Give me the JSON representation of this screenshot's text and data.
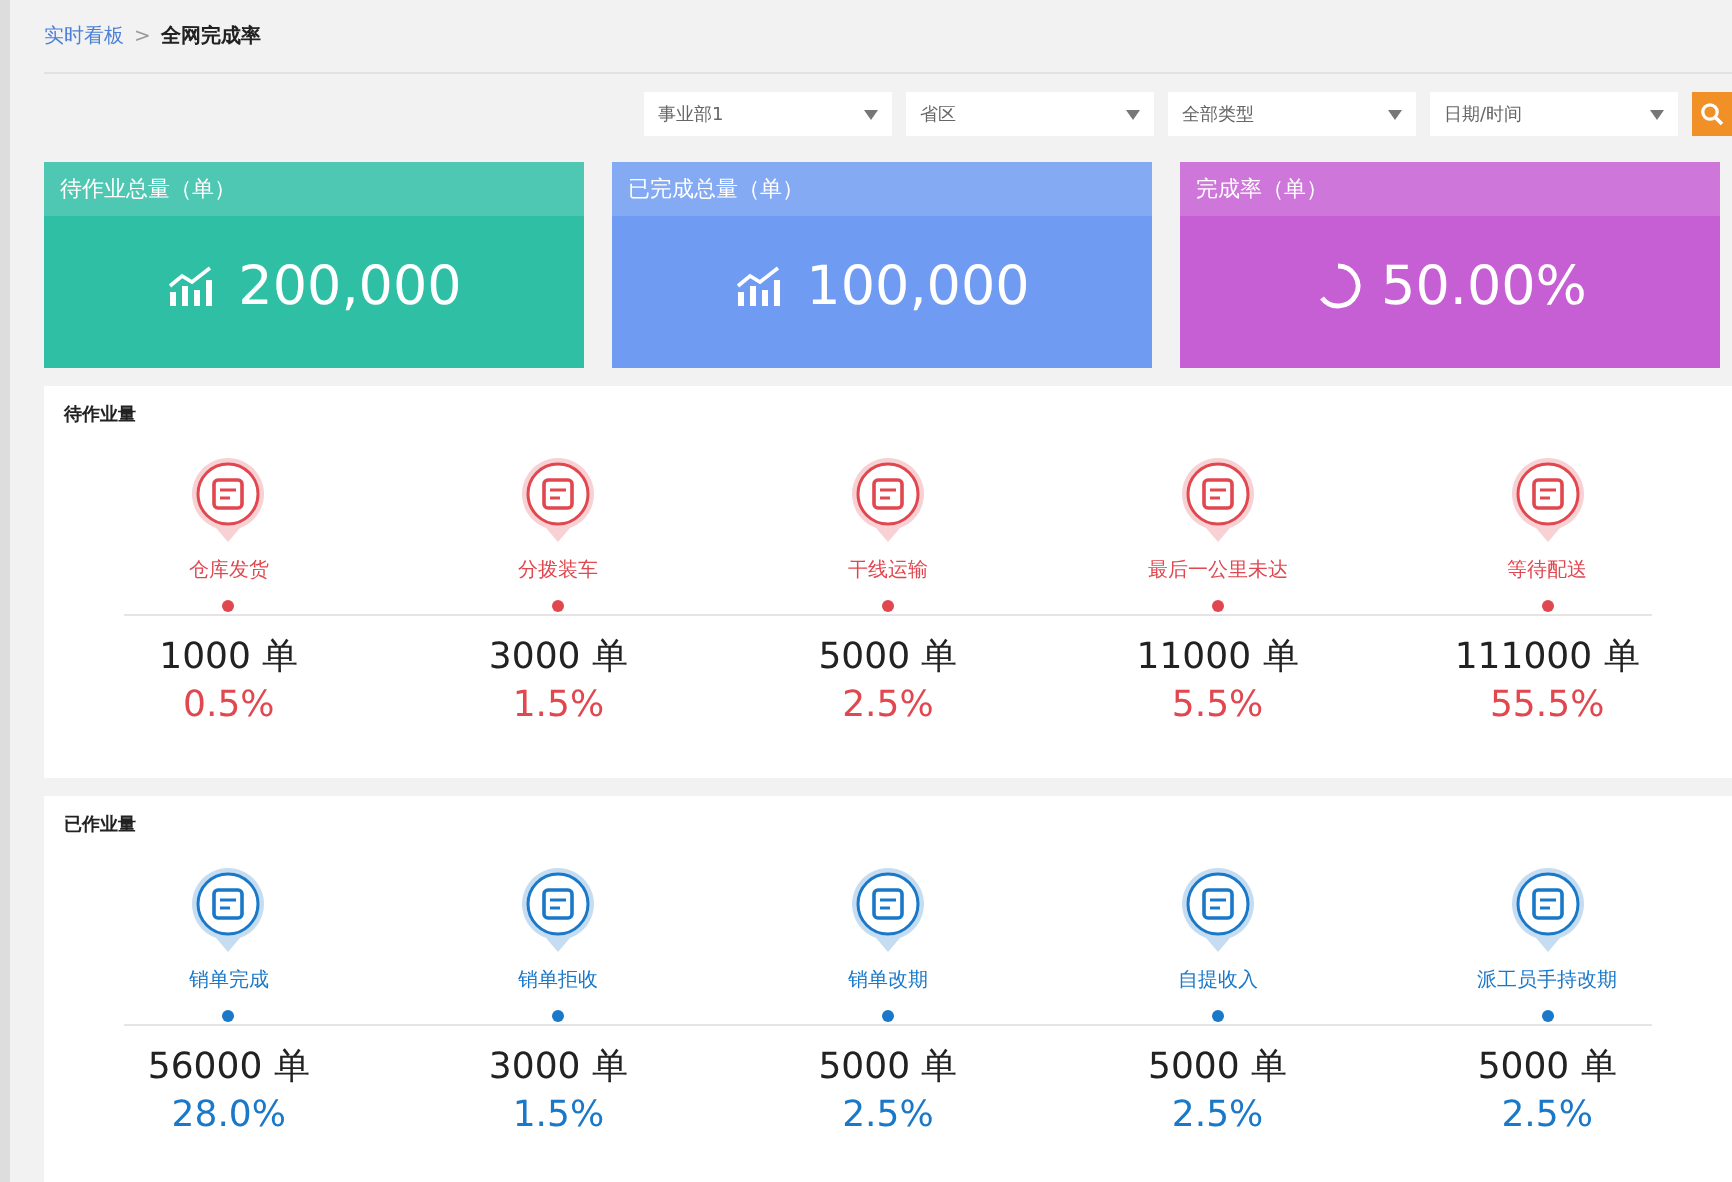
{
  "breadcrumb": {
    "parent": "实时看板",
    "separator": ">",
    "current": "全网完成率"
  },
  "filters": [
    {
      "value": "事业部1"
    },
    {
      "value": "省区"
    },
    {
      "value": "全部类型"
    },
    {
      "value": "日期/时间"
    }
  ],
  "stat_cards": [
    {
      "title": "待作业总量（单）",
      "value": "200,000",
      "kind": "trend",
      "color": "#2fbfa5"
    },
    {
      "title": "已完成总量（单）",
      "value": "100,000",
      "kind": "trend",
      "color": "#6f9cf2"
    },
    {
      "title": "完成率（单）",
      "value": "50.00%",
      "kind": "progress",
      "color": "#c65fd3"
    }
  ],
  "sections": [
    {
      "title": "待作业量",
      "kind": "pending",
      "items": [
        {
          "label": "仓库发货",
          "count": "1000 单",
          "percent": "0.5%"
        },
        {
          "label": "分拨装车",
          "count": "3000 单",
          "percent": "1.5%"
        },
        {
          "label": "干线运输",
          "count": "5000 单",
          "percent": "2.5%"
        },
        {
          "label": "最后一公里未达",
          "count": "11000 单",
          "percent": "5.5%"
        },
        {
          "label": "等待配送",
          "count": "111000 单",
          "percent": "55.5%"
        }
      ]
    },
    {
      "title": "已作业量",
      "kind": "done",
      "items": [
        {
          "label": "销单完成",
          "count": "56000 单",
          "percent": "28.0%"
        },
        {
          "label": "销单拒收",
          "count": "3000 单",
          "percent": "1.5%"
        },
        {
          "label": "销单改期",
          "count": "5000 单",
          "percent": "2.5%"
        },
        {
          "label": "自提收入",
          "count": "5000 单",
          "percent": "2.5%"
        },
        {
          "label": "派工员手持改期",
          "count": "5000 单",
          "percent": "2.5%"
        }
      ]
    }
  ]
}
